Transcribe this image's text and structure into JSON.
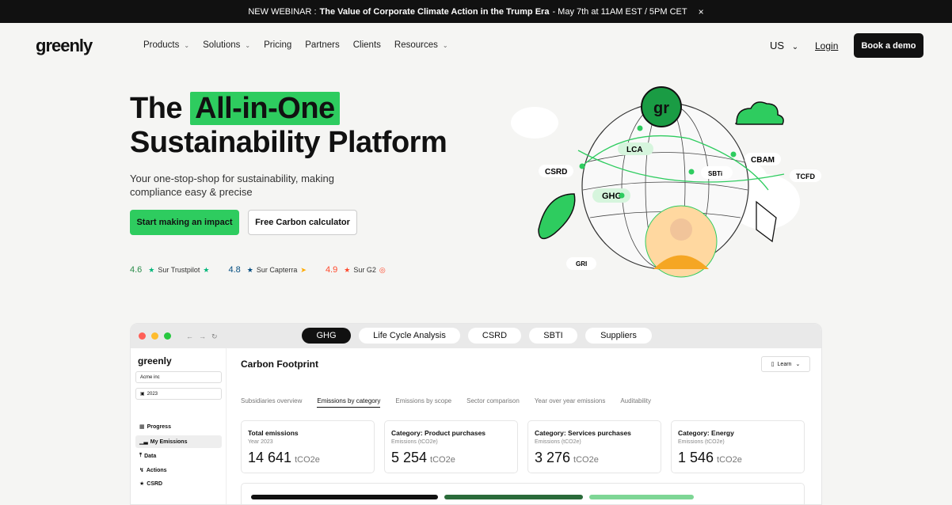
{
  "announcement": {
    "prefix": "NEW WEBINAR :",
    "title": "The Value of Corporate Climate Action in the Trump Era",
    "details": "- May 7th at 11AM EST / 5PM CET",
    "close": "×"
  },
  "nav": {
    "logo": "greenly",
    "items": [
      {
        "label": "Products",
        "dropdown": true
      },
      {
        "label": "Solutions",
        "dropdown": true
      },
      {
        "label": "Pricing",
        "dropdown": false
      },
      {
        "label": "Partners",
        "dropdown": false
      },
      {
        "label": "Clients",
        "dropdown": false
      },
      {
        "label": "Resources",
        "dropdown": true
      }
    ],
    "region": "US",
    "login": "Login",
    "demo": "Book a demo"
  },
  "hero": {
    "title_prefix": "The",
    "title_highlight": "All-in-One",
    "title_line2": "Sustainability Platform",
    "subtitle": "Your one-stop-shop for sustainability, making compliance easy & precise",
    "cta_primary": "Start making an impact",
    "cta_secondary": "Free Carbon calculator",
    "ratings": [
      {
        "score": "4.6",
        "label": "Sur Trustpilot",
        "color": "#00b67a"
      },
      {
        "score": "4.8",
        "label": "Sur Capterra",
        "color": "#044d80"
      },
      {
        "score": "4.9",
        "label": "Sur G2",
        "color": "#ff492c"
      }
    ]
  },
  "illustration": {
    "labels": [
      "LCA",
      "CSRD",
      "SBTi",
      "CBAM",
      "TCFD",
      "GHG",
      "GRI"
    ],
    "badge": "gr"
  },
  "app": {
    "tabs": [
      "GHG",
      "Life Cycle Analysis",
      "CSRD",
      "SBTI",
      "Suppliers"
    ],
    "sidebar": {
      "logo": "greenly",
      "company": "Acme inc",
      "year": "2023",
      "items": [
        "Progress",
        "My Emissions",
        "Data",
        "Actions",
        "CSRD"
      ]
    },
    "main": {
      "title": "Carbon Footprint",
      "learn": "Learn",
      "subtabs": [
        "Subsidiaries overview",
        "Emissions by category",
        "Emissions by scope",
        "Sector comparison",
        "Year over year emissions",
        "Auditability"
      ],
      "cards": [
        {
          "title": "Total emissions",
          "sub": "Year 2023",
          "value": "14 641",
          "unit": "tCO2e"
        },
        {
          "title": "Category: Product purchases",
          "sub": "Emissions (tCO2e)",
          "value": "5 254",
          "unit": "tCO2e"
        },
        {
          "title": "Category: Services purchases",
          "sub": "Emissions (tCO2e)",
          "value": "3 276",
          "unit": "tCO2e"
        },
        {
          "title": "Category: Energy",
          "sub": "Emissions (tCO2e)",
          "value": "1 546",
          "unit": "tCO2e"
        }
      ]
    }
  },
  "colors": {
    "accent": "#2ecc5f",
    "dark": "#111111",
    "bg": "#f5f5f3"
  }
}
